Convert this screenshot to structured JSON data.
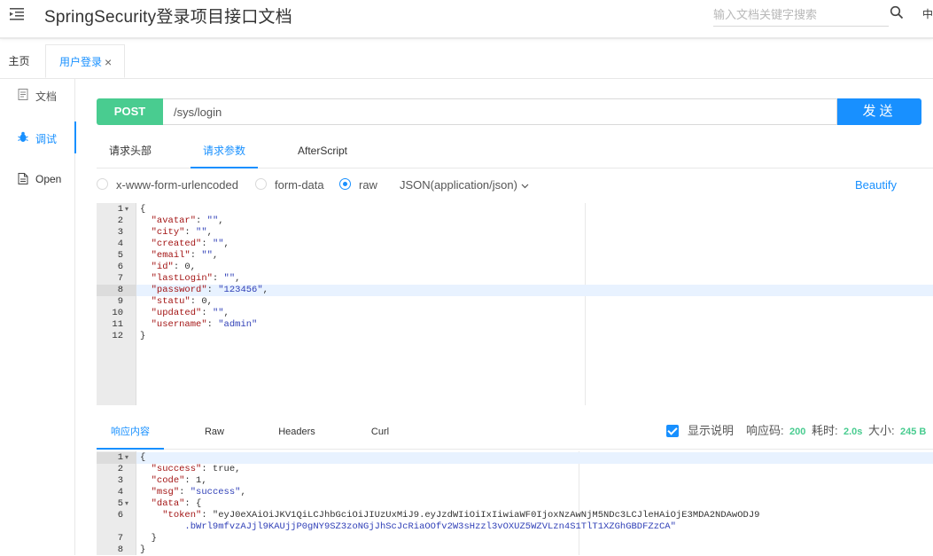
{
  "header": {
    "title": "SpringSecurity登录项目接口文档",
    "search_placeholder": "输入文档关键字搜索",
    "lang": "中"
  },
  "tabs": [
    {
      "label": "主页"
    },
    {
      "label": "用户登录",
      "close": "×"
    }
  ],
  "sidebar": {
    "items": [
      {
        "label": "文档",
        "icon": "document-icon"
      },
      {
        "label": "调试",
        "icon": "bug-icon"
      },
      {
        "label": "Open",
        "icon": "file-icon"
      }
    ]
  },
  "request": {
    "method": "POST",
    "url": "/sys/login",
    "send_label": "发送",
    "tabs": [
      "请求头部",
      "请求参数",
      "AfterScript"
    ],
    "active_tab": "请求参数",
    "body_types": [
      "x-www-form-urlencoded",
      "form-data",
      "raw"
    ],
    "selected_body_type": "raw",
    "content_type": "JSON(application/json)",
    "beautify_label": "Beautify",
    "body_lines": [
      "{",
      "  \"avatar\": \"\",",
      "  \"city\": \"\",",
      "  \"created\": \"\",",
      "  \"email\": \"\",",
      "  \"id\": 0,",
      "  \"lastLogin\": \"\",",
      "  \"password\": \"123456\",",
      "  \"statu\": 0,",
      "  \"updated\": \"\",",
      "  \"username\": \"admin\"",
      "}"
    ],
    "active_line": 8
  },
  "response": {
    "tabs": [
      "响应内容",
      "Raw",
      "Headers",
      "Curl"
    ],
    "active_tab": "响应内容",
    "show_desc_label": "显示说明",
    "show_desc_checked": true,
    "status_label": "响应码:",
    "status_value": "200",
    "time_label": "耗时:",
    "time_value": "2.0s",
    "size_label": "大小:",
    "size_value": "245 B",
    "body_lines": [
      {
        "n": "1",
        "text": "{"
      },
      {
        "n": "2",
        "text": "  \"success\": true,"
      },
      {
        "n": "3",
        "text": "  \"code\": 1,"
      },
      {
        "n": "4",
        "text": "  \"msg\": \"success\","
      },
      {
        "n": "5",
        "text": "  \"data\": {"
      },
      {
        "n": "6",
        "text": "    \"token\": \"eyJ0eXAiOiJKV1QiLCJhbGciOiJIUzUxMiJ9.eyJzdWIiOiIxIiwiaWF0IjoxNzAwNjM5NDc3LCJleHAiOjE3MDA2NDAwODJ9"
      },
      {
        "n": "",
        "text": "        .bWrl9mfvzAJjl9KAUjjP0gNY9SZ3zoNGjJhScJcRiaOOfv2W3sHzzl3vOXUZ5WZVLzn4S1TlT1XZGhGBDFZzCA\""
      },
      {
        "n": "7",
        "text": "  }"
      },
      {
        "n": "8",
        "text": "}"
      }
    ]
  }
}
